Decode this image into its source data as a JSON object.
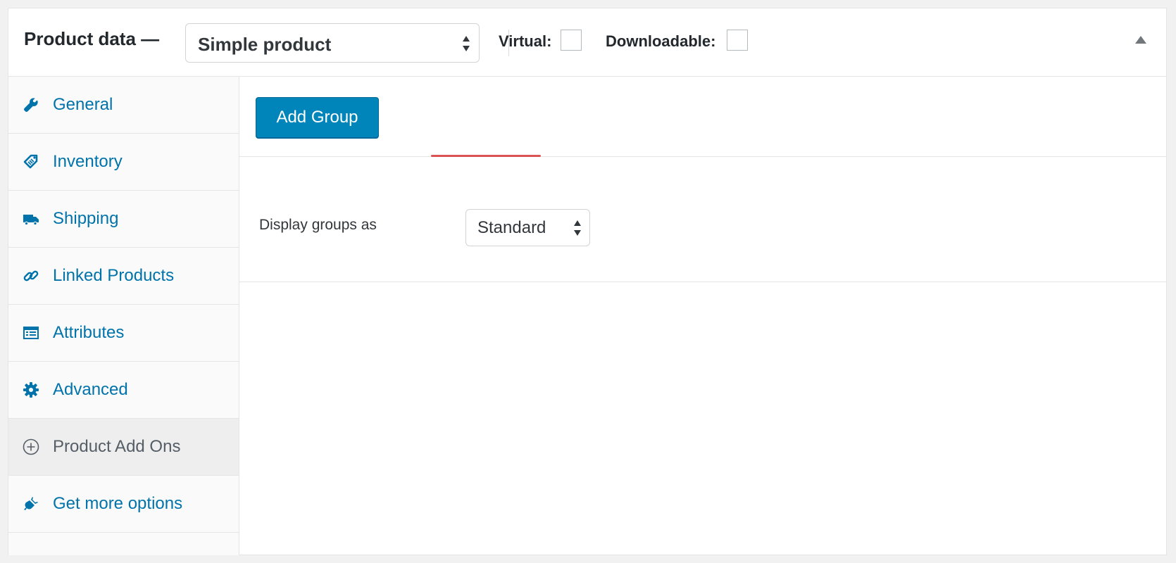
{
  "header": {
    "title": "Product data —",
    "product_type": "Simple product",
    "virtual_label": "Virtual:",
    "downloadable_label": "Downloadable:",
    "virtual_checked": false,
    "downloadable_checked": false
  },
  "sidebar": {
    "items": [
      {
        "label": "General",
        "icon": "wrench-icon"
      },
      {
        "label": "Inventory",
        "icon": "tag-icon"
      },
      {
        "label": "Shipping",
        "icon": "truck-icon"
      },
      {
        "label": "Linked Products",
        "icon": "link-icon"
      },
      {
        "label": "Attributes",
        "icon": "list-view-icon"
      },
      {
        "label": "Advanced",
        "icon": "gear-icon"
      },
      {
        "label": "Product Add Ons",
        "icon": "plus-circle-icon",
        "active": true
      },
      {
        "label": "Get more options",
        "icon": "plugin-icon"
      }
    ]
  },
  "main": {
    "add_group_label": "Add Group",
    "display_groups_label": "Display groups as",
    "display_groups_value": "Standard"
  },
  "colors": {
    "link": "#0073aa",
    "button": "#0085ba",
    "active_tab_bg": "#eeeeee"
  }
}
